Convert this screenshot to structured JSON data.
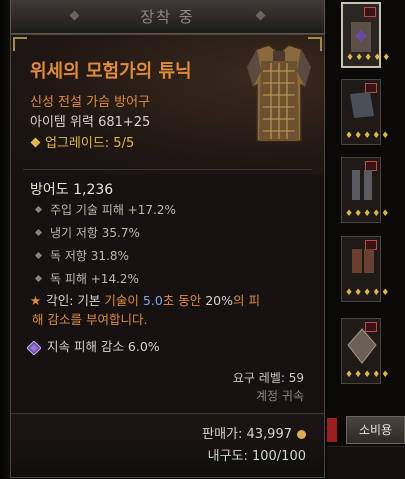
{
  "header": {
    "title": "장착 중"
  },
  "item": {
    "name": "위세의 모험가의 튜닉",
    "type": "신성 전설 가슴 방어구",
    "power": "아이템 위력 681+25",
    "upgrade": "업그레이드: 5/5",
    "armor": "방어도 1,236",
    "stats": [
      "주입 기술 피해 +17.2%",
      "냉기 저항 35.7%",
      "독 저항 31.8%",
      "독 피해 +14.2%"
    ],
    "aspect": {
      "prefix": "각인: 기본 ",
      "highlight1": "기술이",
      "space": " ",
      "value": "5.0",
      "mid": "초 동안 ",
      "pct": "20%",
      "line_end": "의 피",
      "line2": "해 감소를 부여합니다."
    },
    "socket": "지속 피해 감소 6.0%",
    "required_level": "요구 레벨: 59",
    "account_bound": "계정 귀속",
    "sell_price": "판매가: 43,997",
    "durability": "내구도: 100/100"
  },
  "sidebar": {
    "slots": [
      {
        "stars": "♦♦♦♦♦"
      },
      {
        "stars": "♦♦♦♦♦"
      },
      {
        "stars": "♦♦♦♦♦"
      },
      {
        "stars": "♦♦♦♦♦"
      },
      {
        "stars": "♦♦♦♦♦"
      }
    ],
    "salvage_label": "소비용"
  },
  "colors": {
    "legendary": "#e08a3b",
    "upgrade": "#e0b84a",
    "highlight": "#7fa6e8"
  }
}
